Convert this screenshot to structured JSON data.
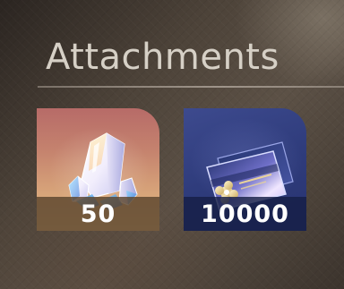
{
  "section": {
    "title": "Attachments"
  },
  "attachments": [
    {
      "name": "crystal",
      "icon": "crystal-icon",
      "quantity": "50",
      "accent": "#c88372"
    },
    {
      "name": "ticket",
      "icon": "ticket-card-icon",
      "quantity": "10000",
      "accent": "#34417f"
    }
  ]
}
